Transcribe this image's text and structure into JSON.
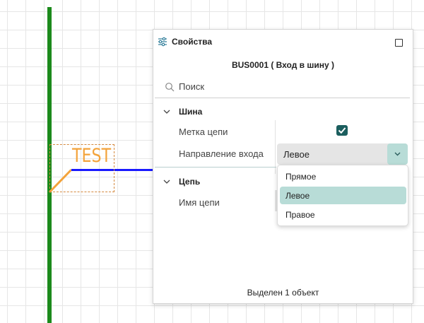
{
  "panel": {
    "title": "Свойства",
    "object_title": "BUS0001 ( Вход в шину )",
    "search": {
      "placeholder": "Поиск",
      "value": ""
    },
    "sections": [
      {
        "label": "Шина",
        "properties": [
          {
            "label": "Метка цепи",
            "checked": true
          },
          {
            "label": "Направление входа",
            "value": "Левое"
          }
        ]
      },
      {
        "label": "Цепь",
        "properties": [
          {
            "label": "Имя цепи",
            "value": ""
          }
        ]
      }
    ],
    "status": "Выделен 1 объект"
  },
  "dropdown": {
    "options": [
      "Прямое",
      "Левое",
      "Правое"
    ],
    "selected": "Левое"
  },
  "canvas": {
    "net_label": "TEST"
  },
  "colors": {
    "accent": "#1b5e5e",
    "accent_light": "#b8dcd7",
    "bus_line": "#1c8a1c",
    "wire": "#1a1aff",
    "label": "#f3a33b"
  }
}
